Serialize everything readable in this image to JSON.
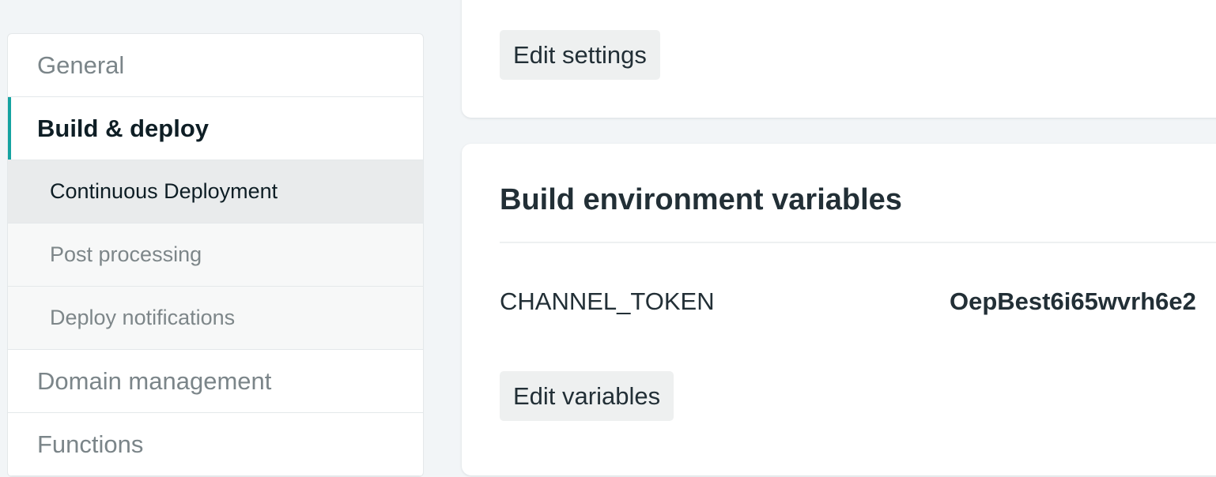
{
  "sidebar": {
    "items": [
      {
        "label": "General"
      },
      {
        "label": "Build & deploy"
      }
    ],
    "subitems": [
      {
        "label": "Continuous Deployment"
      },
      {
        "label": "Post processing"
      },
      {
        "label": "Deploy notifications"
      }
    ],
    "more_items": [
      {
        "label": "Domain management"
      },
      {
        "label": "Functions"
      }
    ]
  },
  "build_settings_card": {
    "edit_button_label": "Edit settings"
  },
  "env_card": {
    "title": "Build environment variables",
    "variables": [
      {
        "key": "CHANNEL_TOKEN",
        "value": "OepBest6i65wvrh6e2"
      }
    ],
    "edit_button_label": "Edit variables"
  },
  "colors": {
    "accent": "#15a3a1",
    "page_background": "#f2f5f7",
    "text_dark": "#222f36",
    "text_muted": "#7b8589"
  }
}
